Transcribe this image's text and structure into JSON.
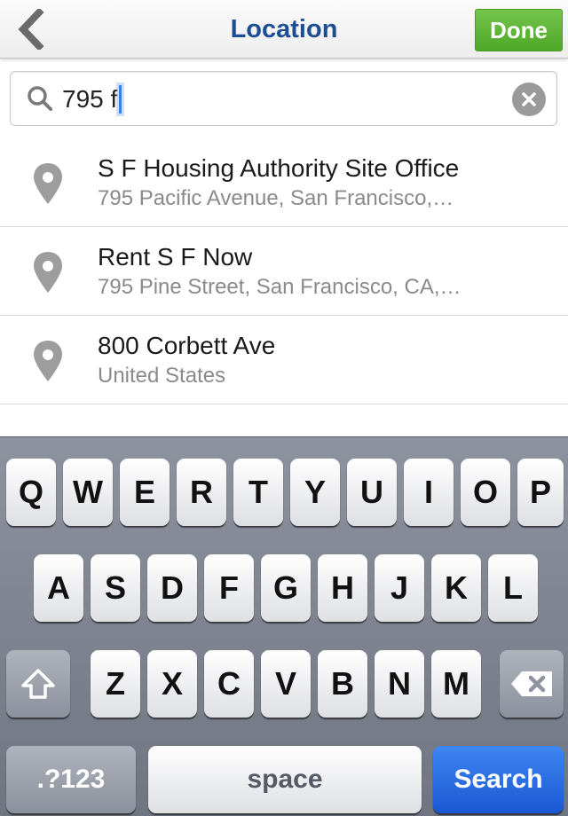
{
  "nav": {
    "title": "Location",
    "done_label": "Done",
    "back_icon": "chevron-left-icon",
    "title_color": "#1d4e93",
    "done_color": "#5cb336"
  },
  "search": {
    "value": "795 f",
    "search_icon": "magnifier-icon",
    "clear_icon": "clear-icon"
  },
  "results": [
    {
      "name": "S F Housing Authority Site Office",
      "address": "795 Pacific Avenue, San Francisco,…"
    },
    {
      "name": "Rent S F Now",
      "address": "795 Pine Street, San Francisco, CA,…"
    },
    {
      "name": "800 Corbett Ave",
      "address": "United States"
    }
  ],
  "keyboard": {
    "row1": [
      "Q",
      "W",
      "E",
      "R",
      "T",
      "Y",
      "U",
      "I",
      "O",
      "P"
    ],
    "row2": [
      "A",
      "S",
      "D",
      "F",
      "G",
      "H",
      "J",
      "K",
      "L"
    ],
    "row3": [
      "Z",
      "X",
      "C",
      "V",
      "B",
      "N",
      "M"
    ],
    "numbers_label": ".?123",
    "space_label": "space",
    "search_label": "Search",
    "shift_icon": "shift-icon",
    "delete_icon": "backspace-icon",
    "search_key_color": "#2f6fe6"
  }
}
